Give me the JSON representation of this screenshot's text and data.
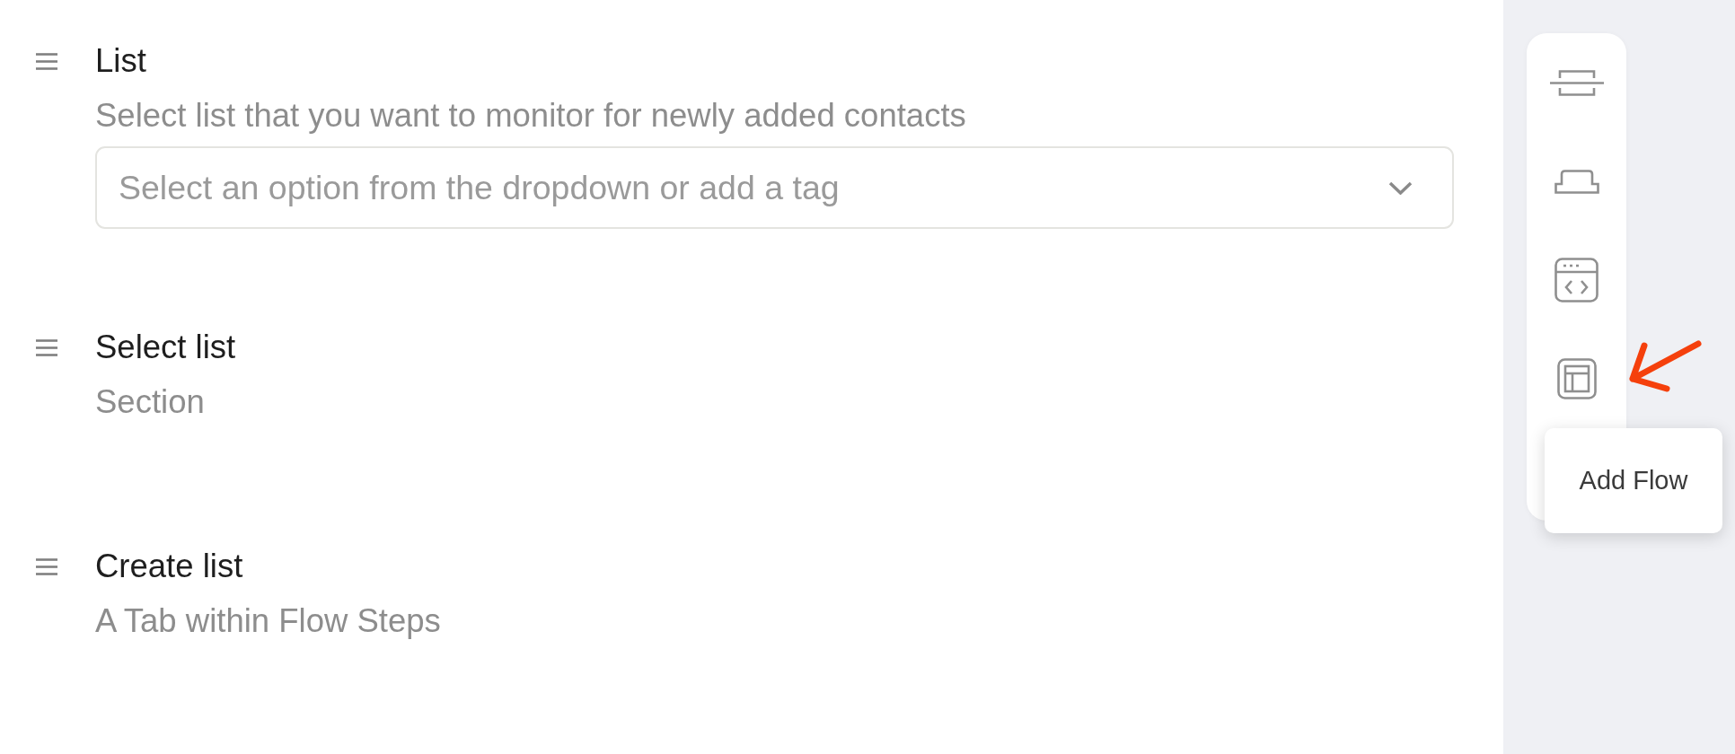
{
  "fields": [
    {
      "title": "List",
      "description": "Select list that you want to monitor for newly added contacts",
      "input": {
        "kind": "dropdown",
        "placeholder": "Select an option from the dropdown or add a tag"
      }
    },
    {
      "title": "Select list",
      "description": "Section"
    },
    {
      "title": "Create list",
      "description": "A Tab within Flow Steps"
    }
  ],
  "toolbar": {
    "items": [
      {
        "kind": "divider"
      },
      {
        "kind": "tab"
      },
      {
        "kind": "code"
      },
      {
        "kind": "layout"
      }
    ],
    "tooltip": {
      "text": "Add Flow"
    }
  },
  "annotations": [
    {
      "kind": "arrow"
    }
  ]
}
